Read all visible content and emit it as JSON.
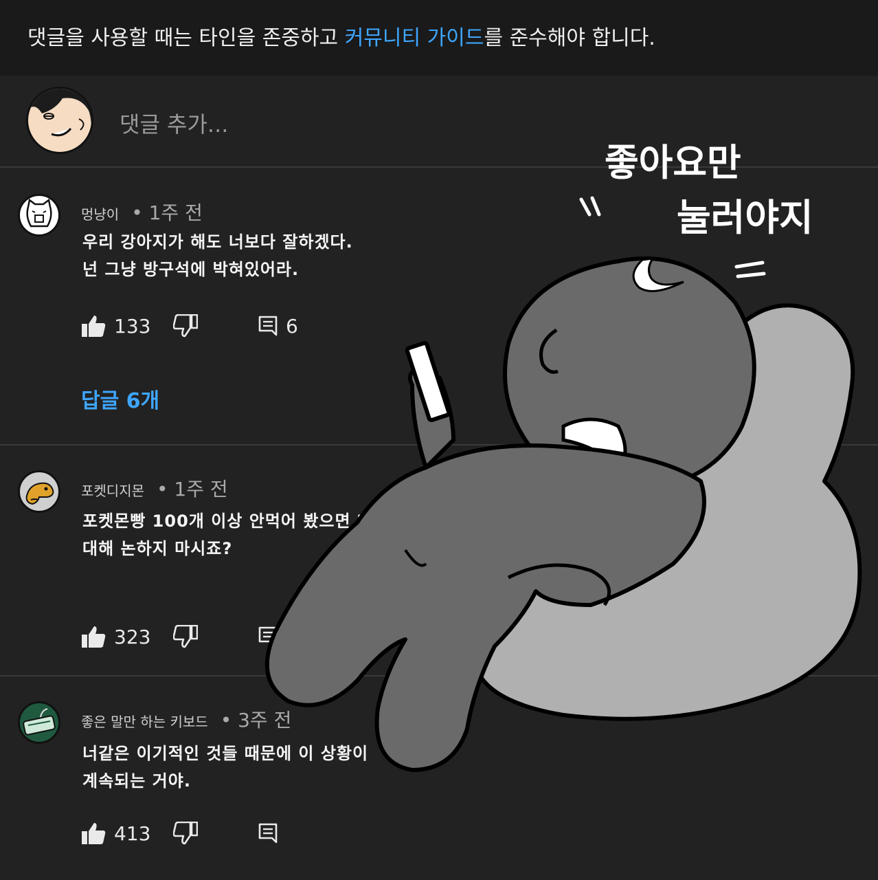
{
  "banner": {
    "prefix": "댓글을 사용할 때는 타인을 존중하고 ",
    "link": "커뮤니티 가이드",
    "suffix": "를 준수해야 합니다."
  },
  "add_comment": {
    "placeholder": "댓글 추가..."
  },
  "comments": [
    {
      "author": "멍냥이",
      "time": "• 1주 전",
      "text": "우리 강아지가 해도 너보다 잘하겠다.\n넌 그냥 방구석에 박혀있어라.",
      "likes": "133",
      "reply_count": "6",
      "replies_link": "답글 6개"
    },
    {
      "author": "포켓디지몬",
      "time": "• 1주 전",
      "text": "포켓몬빵 100개 이상 안먹어 봤으면 대\n대해 논하지 마시죠?",
      "likes": "323"
    },
    {
      "author": "좋은 말만 하는 키보드",
      "time": "• 3주 전",
      "text": "너같은 이기적인 것들 때문에 이 상황이\n계속되는 거야.",
      "likes": "413"
    }
  ],
  "cartoon": {
    "caption_line1": "좋아요만",
    "caption_line2": "눌러야지",
    "colors": {
      "body": "#6a6a6a",
      "pillow": "#b0b0b0",
      "outline": "#000000"
    }
  },
  "icons": [
    "thumbs-up-icon",
    "thumbs-down-icon",
    "reply-icon"
  ],
  "colors": {
    "background": "#222222",
    "banner": "#1a1a1a",
    "link": "#3ea6ff"
  }
}
